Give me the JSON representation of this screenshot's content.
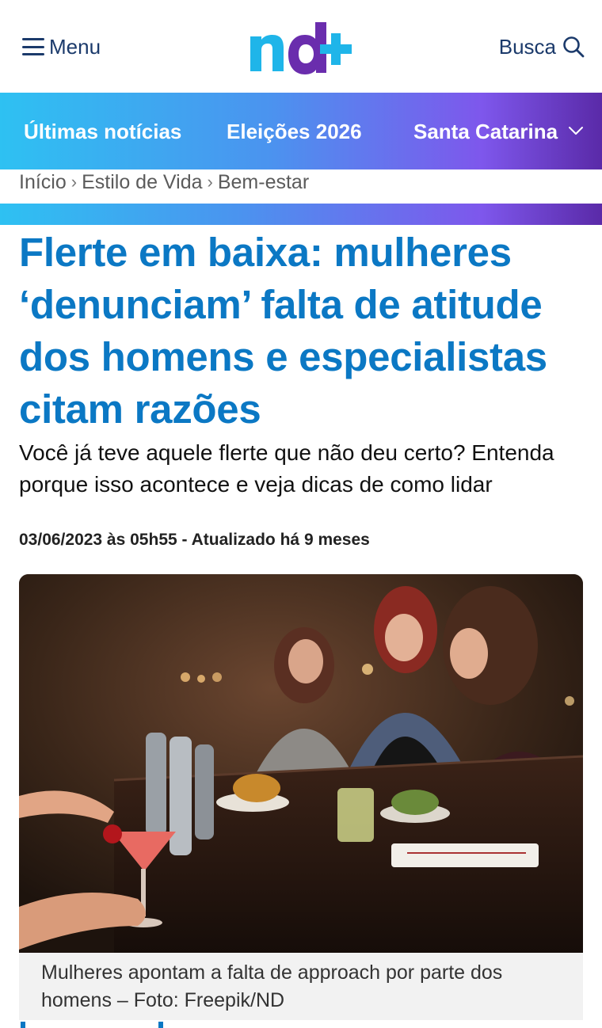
{
  "header": {
    "menu_label": "Menu",
    "search_label": "Busca",
    "logo_text": "nd+",
    "colors": {
      "logo_blue": "#1fb5e9",
      "logo_purple": "#6a2dad",
      "text": "#1b3a6b"
    }
  },
  "nav": {
    "items": [
      {
        "label": "Últimas notícias"
      },
      {
        "label": "Eleições 2026"
      },
      {
        "label": "Santa Catarina"
      }
    ],
    "dropdown_icon": "chevron-down-icon"
  },
  "breadcrumb": {
    "items": [
      {
        "label": "Início"
      },
      {
        "label": "Estilo de Vida"
      },
      {
        "label": "Bem-estar"
      }
    ],
    "separator": "›"
  },
  "article": {
    "title": "Flerte em baixa: mulheres ‘denunciam’ falta de atitude dos homens e especialistas citam razões",
    "subtitle": "Você já teve aquele flerte que não deu certo? Entenda porque isso acontece e veja dicas de como lidar",
    "published": "03/06/2023 às 05h55",
    "date_separator": "-",
    "updated": "Atualizado há 9 meses",
    "image_caption": "Mulheres apontam a falta de approach por parte dos homens – Foto: Freepik/ND",
    "colors": {
      "title": "#0b78c4"
    }
  }
}
